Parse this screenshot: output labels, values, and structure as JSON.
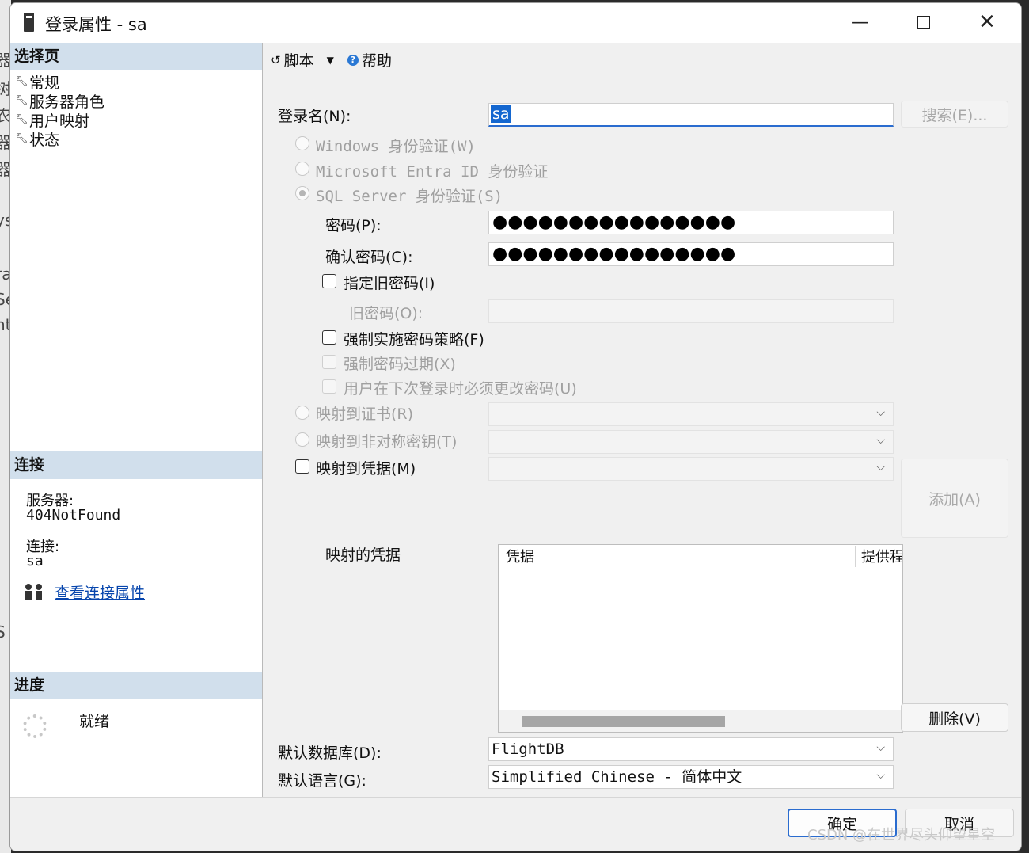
{
  "window": {
    "title": "登录属性 - sa"
  },
  "left": {
    "select_page_header": "选择页",
    "nav_items": [
      "常规",
      "服务器角色",
      "用户映射",
      "状态"
    ],
    "connection_header": "连接",
    "server_label": "服务器:",
    "server_value": "404NotFound",
    "connection_label": "连接:",
    "connection_value": "sa",
    "view_props_link": "查看连接属性",
    "progress_header": "进度",
    "progress_status": "就绪"
  },
  "toolbar": {
    "script_label": "脚本",
    "help_label": "帮助"
  },
  "form": {
    "login_name_label": "登录名(N):",
    "login_name_value": "sa",
    "search_button": "搜索(E)...",
    "windows_auth": "Windows 身份验证(W)",
    "entra_auth": "Microsoft Entra ID 身份验证",
    "sql_auth": "SQL Server 身份验证(S)",
    "password_label": "密码(P):",
    "password_value": "●●●●●●●●●●●●●●●●",
    "confirm_label": "确认密码(C):",
    "confirm_value": "●●●●●●●●●●●●●●●●",
    "specify_old_label": "指定旧密码(I)",
    "old_password_label": "旧密码(O):",
    "enforce_policy_label": "强制实施密码策略(F)",
    "enforce_expiration_label": "强制密码过期(X)",
    "must_change_label": "用户在下次登录时必须更改密码(U)",
    "map_cert_label": "映射到证书(R)",
    "map_asym_label": "映射到非对称密钥(T)",
    "map_cred_label": "映射到凭据(M)",
    "add_button": "添加(A)",
    "mapped_creds_label": "映射的凭据",
    "grid_col_cred": "凭据",
    "grid_col_provider": "提供程",
    "remove_button": "删除(V)",
    "default_db_label": "默认数据库(D):",
    "default_db_value": "FlightDB",
    "default_lang_label": "默认语言(G):",
    "default_lang_value": "Simplified Chinese - 简体中文"
  },
  "footer": {
    "ok_button": "确定",
    "cancel_button": "取消"
  },
  "watermark": "CSDN @在世界尽头仰望星空"
}
